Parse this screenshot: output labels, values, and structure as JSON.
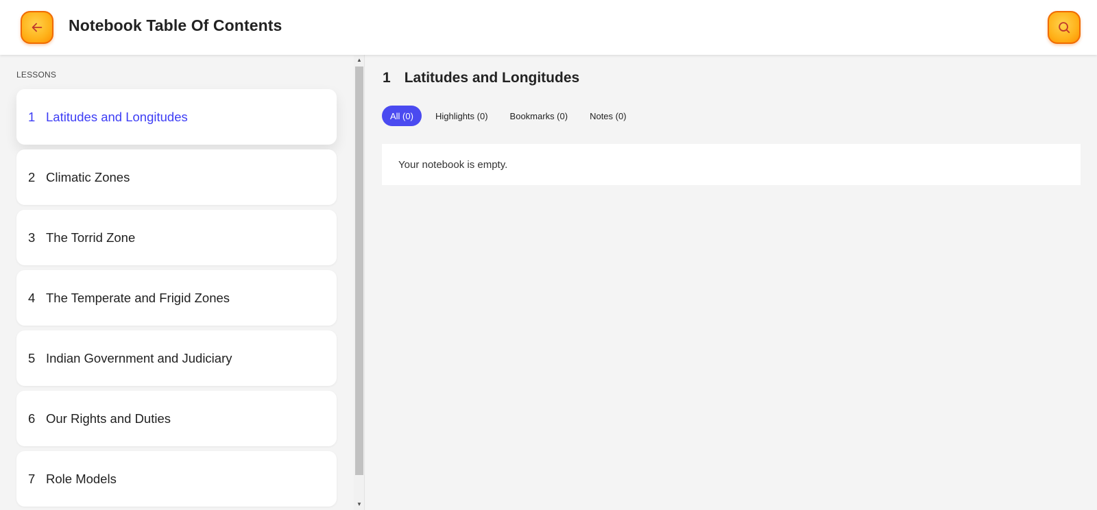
{
  "header": {
    "title": "Notebook Table Of Contents",
    "back_icon": "arrow-left-icon",
    "search_icon": "search-icon",
    "accent": "#ffb21a"
  },
  "sidebar": {
    "section_label": "LESSONS",
    "items": [
      {
        "num": "1",
        "label": "Latitudes and Longitudes",
        "active": true
      },
      {
        "num": "2",
        "label": "Climatic Zones"
      },
      {
        "num": "3",
        "label": "The Torrid Zone"
      },
      {
        "num": "4",
        "label": "The Temperate and Frigid Zones"
      },
      {
        "num": "5",
        "label": "Indian Government and Judiciary"
      },
      {
        "num": "6",
        "label": "Our Rights and Duties"
      },
      {
        "num": "7",
        "label": "Role Models"
      }
    ],
    "active_color": "#3d3df5"
  },
  "main": {
    "lesson_num": "1",
    "lesson_title": "Latitudes and Longitudes",
    "filters": [
      {
        "label": "All (0)",
        "active": true
      },
      {
        "label": "Highlights (0)"
      },
      {
        "label": "Bookmarks (0)"
      },
      {
        "label": "Notes (0)"
      }
    ],
    "empty_message": "Your notebook is empty.",
    "filter_active_color": "#4a4af0"
  }
}
